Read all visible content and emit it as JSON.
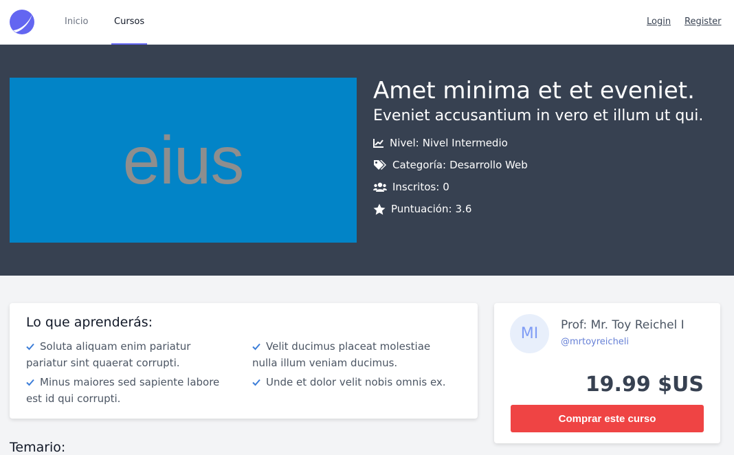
{
  "nav": {
    "links": [
      {
        "label": "Inicio"
      },
      {
        "label": "Cursos"
      }
    ],
    "login_label": "Login",
    "register_label": "Register"
  },
  "hero": {
    "image_text": "eius",
    "title": "Amet minima et et eveniet.",
    "subtitle": "Eveniet accusantium in vero et illum ut qui.",
    "meta": [
      {
        "icon": "chart-line-icon",
        "label": "Nivel:",
        "value": "Nivel Intermedio"
      },
      {
        "icon": "tags-icon",
        "label": "Categoría:",
        "value": "Desarrollo Web"
      },
      {
        "icon": "users-icon",
        "label": "Inscritos:",
        "value": "0"
      },
      {
        "icon": "star-icon",
        "label": "Puntuación:",
        "value": "3.6"
      }
    ]
  },
  "learn": {
    "title": "Lo que aprenderás:",
    "items": [
      "Soluta aliquam enim pariatur pariatur sint quaerat corrupti.",
      "Velit ducimus placeat molestiae nulla illum veniam ducimus.",
      "Minus maiores sed sapiente labore est id qui corrupti.",
      "Unde et dolor velit nobis omnis ex."
    ]
  },
  "temario": {
    "title": "Temario:"
  },
  "instructor": {
    "initials": "MI",
    "name": "Prof: Mr. Toy Reichel I",
    "handle": "@mrtoyreicheli",
    "price": "19.99 $US",
    "buy_label": "Comprar este curso"
  },
  "colors": {
    "hero_bg": "#374151",
    "accent": "#6366f1",
    "buy_button": "#ef4444",
    "check": "#3b7dd8"
  }
}
